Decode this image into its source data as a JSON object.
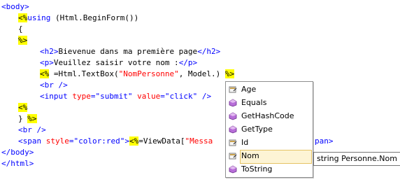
{
  "code": {
    "l1_tag": "<body>",
    "l2_open": "<%",
    "l2_kw": "using",
    "l2_rest": " (Html.BeginForm())",
    "l3": "{",
    "l4": "%>",
    "l5_open": "<h2>",
    "l5_text": "Bievenue dans ma première page",
    "l5_close": "</h2>",
    "l6_open": "<p>",
    "l6_text": "Veuillez saisir votre nom :",
    "l6_close": "</p>",
    "l7_open": "<%",
    "l7_eq": " =Html.TextBox(",
    "l7_str": "\"NomPersonne\"",
    "l7_rest": ", Model.)",
    "l7_close": "%>",
    "l8": "<br />",
    "l9_a": "<input ",
    "l9_type_attr": "type",
    "l9_eq1": "=",
    "l9_type_val": "\"submit\"",
    "l9_sp": " ",
    "l9_value_attr": "value",
    "l9_eq2": "=",
    "l9_value_val": "\"click\"",
    "l9_end": " />",
    "l10": "<%",
    "l11_brace": "} ",
    "l11_close": "%>",
    "l12": "<br />",
    "l13_a": "<span ",
    "l13_attr": "style",
    "l13_eq": "=",
    "l13_val": "\"color:red\"",
    "l13_gt": ">",
    "l13_open": "<%",
    "l13_code": "=ViewData[",
    "l13_str": "\"Messa",
    "l13_tail": "pan>",
    "l14": "</body>",
    "l15": "</html>"
  },
  "intellisense": {
    "items": [
      {
        "label": "Age",
        "icon": "property-icon"
      },
      {
        "label": "Equals",
        "icon": "method-icon"
      },
      {
        "label": "GetHashCode",
        "icon": "method-icon"
      },
      {
        "label": "GetType",
        "icon": "method-icon"
      },
      {
        "label": "Id",
        "icon": "property-icon"
      },
      {
        "label": "Nom",
        "icon": "property-icon"
      },
      {
        "label": "ToString",
        "icon": "method-icon"
      }
    ],
    "selected": "Nom",
    "tooltip": "string Personne.Nom"
  }
}
